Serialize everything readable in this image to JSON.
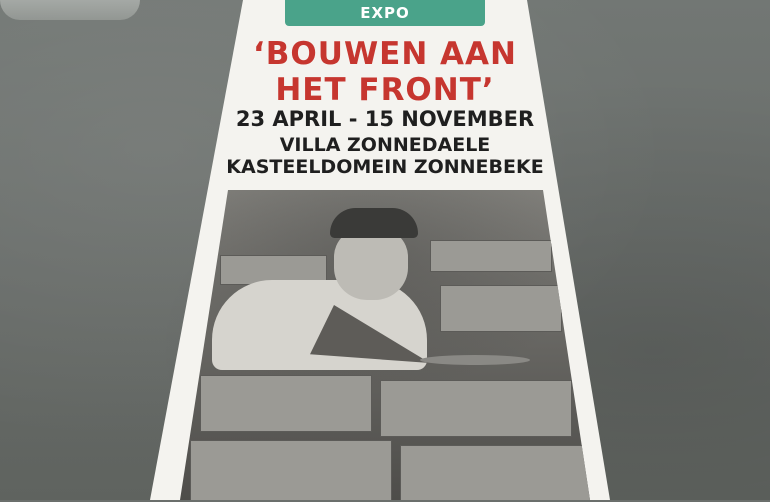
{
  "banner": {
    "badge": "EXPO",
    "title_line1": "‘BOUWEN AAN",
    "title_line2": "HET FRONT’",
    "dates": "23 APRIL - 15 NOVEMBER",
    "venue": "VILLA ZONNEDAELE",
    "place": "KASTEELDOMEIN ZONNEBEKE"
  },
  "colors": {
    "badge": "#4aa38a",
    "title": "#c6362f",
    "text": "#1f1f1f",
    "banner": "#f4f3ef",
    "floor": "#6b6f6c"
  }
}
